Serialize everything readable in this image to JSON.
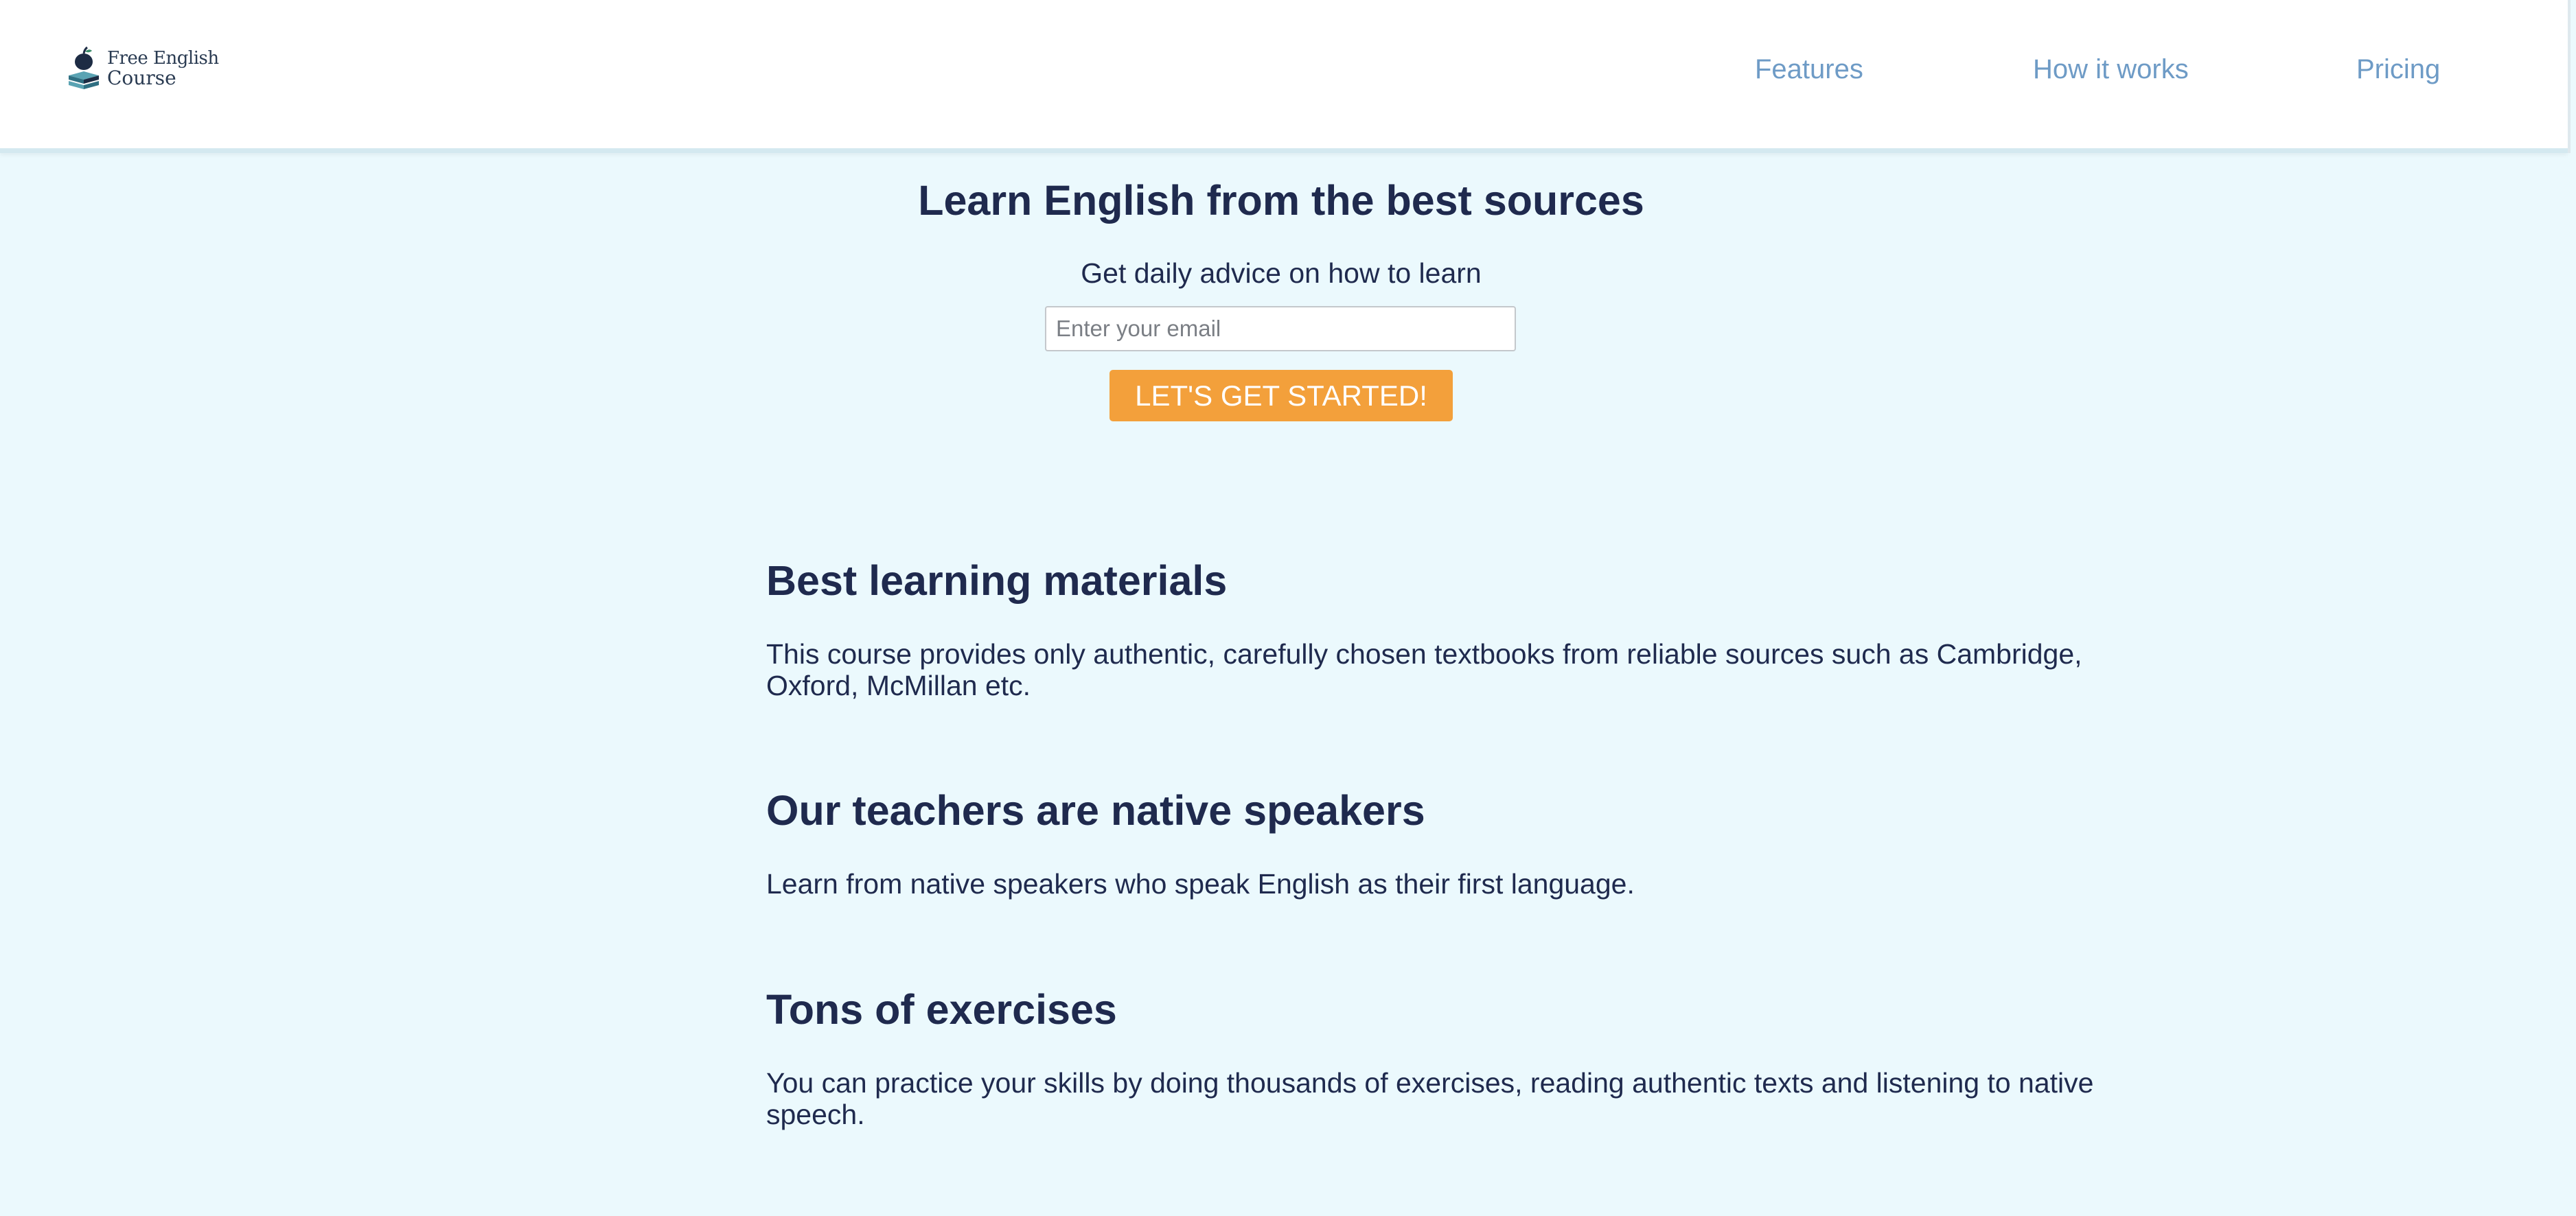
{
  "header": {
    "logo": {
      "line1": "Free English",
      "line2": "Course",
      "icon": "book-apple-icon"
    },
    "nav": [
      {
        "label": "Features"
      },
      {
        "label": "How it works"
      },
      {
        "label": "Pricing"
      }
    ]
  },
  "hero": {
    "title": "Learn English from the best sources",
    "subtitle": "Get daily advice on how to learn",
    "email_placeholder": "Enter your email",
    "email_value": "",
    "cta_label": "LET'S GET STARTED!"
  },
  "features": [
    {
      "title": "Best learning materials",
      "text": "This course provides only authentic, carefully chosen textbooks from reliable sources such as Cambridge, Oxford, McMillan etc."
    },
    {
      "title": "Our teachers are native speakers",
      "text": "Learn from native speakers who speak English as their first language."
    },
    {
      "title": "Tons of exercises",
      "text": "You can practice your skills by doing thousands of exercises, reading authentic texts and listening to native speech."
    }
  ],
  "colors": {
    "background": "#ebf9fd",
    "header": "#ffffff",
    "text": "#1f2a4e",
    "nav_link": "#6e9bc6",
    "cta": "#f3a03b",
    "cta_text": "#ffffff"
  }
}
